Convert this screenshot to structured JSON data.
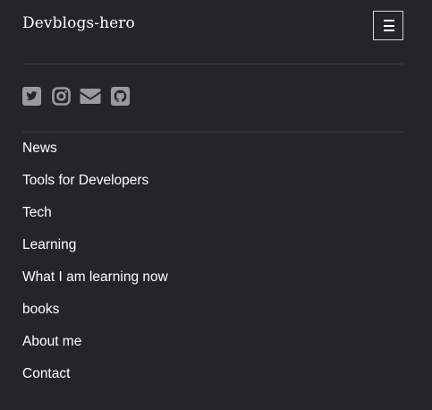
{
  "header": {
    "site_title": "Devblogs-hero",
    "menu_toggle_icon": "hamburger-menu-icon"
  },
  "social": {
    "icon_color": "#9a9a9c",
    "links": [
      {
        "icon": "twitter-icon"
      },
      {
        "icon": "instagram-icon"
      },
      {
        "icon": "email-icon"
      },
      {
        "icon": "github-icon"
      }
    ]
  },
  "nav": {
    "items": [
      {
        "label": "News"
      },
      {
        "label": "Tools for Developers"
      },
      {
        "label": "Tech"
      },
      {
        "label": "Learning"
      },
      {
        "label": "What I am learning now"
      },
      {
        "label": "books"
      },
      {
        "label": "About me"
      },
      {
        "label": "Contact"
      }
    ]
  }
}
